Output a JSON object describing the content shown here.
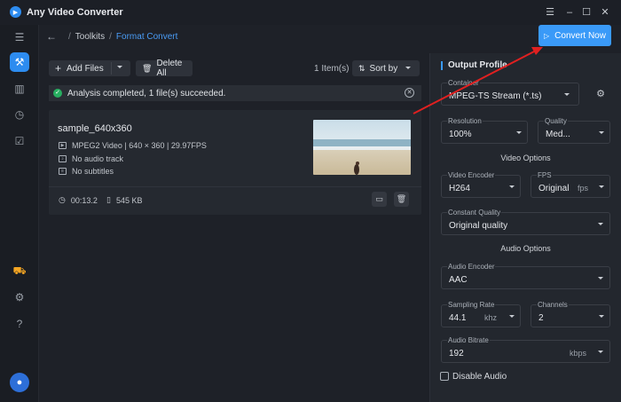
{
  "window": {
    "title": "Any Video Converter",
    "menu_icon": "menu-icon",
    "minimize_icon": "minimize-icon",
    "maximize_icon": "maximize-icon",
    "close_icon": "close-icon"
  },
  "sidebar": {
    "items": [
      "toolbox-icon",
      "library-icon",
      "history-icon",
      "tasks-icon"
    ],
    "bottom": [
      "cart-icon",
      "gear-icon",
      "help-icon",
      "user-icon"
    ]
  },
  "breadcrumb": {
    "items": [
      "Toolkits",
      "Format Convert"
    ],
    "separator": "/"
  },
  "convert_button": {
    "label": "Convert Now"
  },
  "toolbar": {
    "add_files": "Add Files",
    "delete_all": "Delete All",
    "count": "1 Item(s)",
    "sort_by": "Sort by"
  },
  "notice": {
    "text": "Analysis completed, 1 file(s) succeeded."
  },
  "file": {
    "name": "sample_640x360",
    "video_info": "MPEG2 Video | 640 × 360 | 29.97FPS",
    "audio_info": "No audio track",
    "subtitle_info": "No subtitles",
    "duration": "00:13.2",
    "size": "545 KB"
  },
  "output_profile": {
    "title": "Output Profile",
    "container": {
      "label": "Container",
      "value": "MPEG-TS Stream (*.ts)"
    },
    "resolution": {
      "label": "Resolution",
      "value": "100%"
    },
    "quality": {
      "label": "Quality",
      "value": "Med..."
    },
    "video_options_title": "Video Options",
    "video_encoder": {
      "label": "Video Encoder",
      "value": "H264"
    },
    "fps": {
      "label": "FPS",
      "value": "Original",
      "unit": "fps"
    },
    "constant_quality": {
      "label": "Constant Quality",
      "value": "Original quality"
    },
    "audio_options_title": "Audio Options",
    "audio_encoder": {
      "label": "Audio Encoder",
      "value": "AAC"
    },
    "sampling_rate": {
      "label": "Sampling Rate",
      "value": "44.1",
      "unit": "khz"
    },
    "channels": {
      "label": "Channels",
      "value": "2"
    },
    "audio_bitrate": {
      "label": "Audio Bitrate",
      "value": "192",
      "unit": "kbps"
    },
    "disable_audio": {
      "label": "Disable Audio",
      "checked": false
    }
  },
  "colors": {
    "accent": "#3a9af8",
    "success": "#27ae60",
    "annotation_arrow": "#e02020"
  }
}
